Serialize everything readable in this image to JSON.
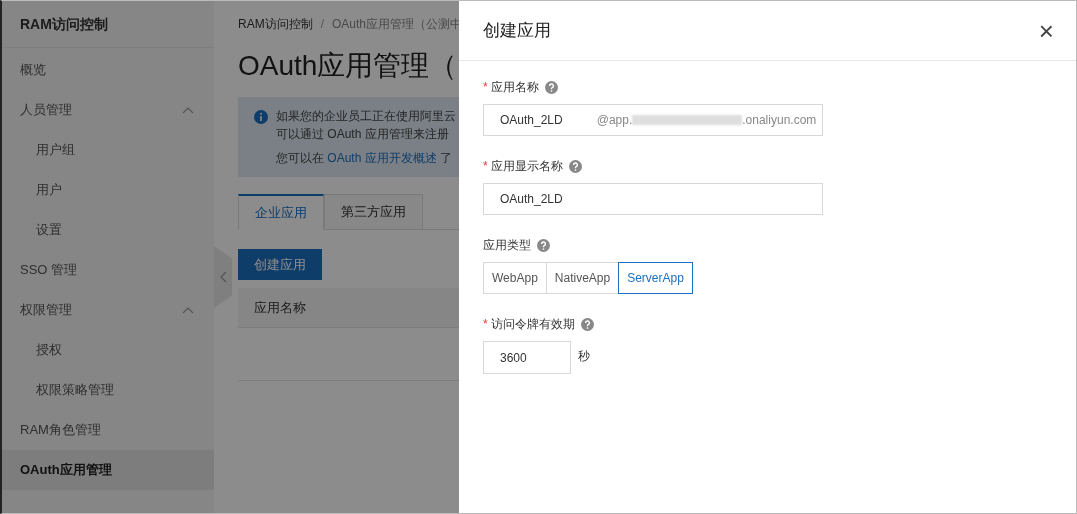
{
  "sidebar": {
    "title": "RAM访问控制",
    "items": [
      {
        "label": "概览",
        "selected": false
      },
      {
        "label": "人员管理",
        "selected": false,
        "expanded": true,
        "children": [
          {
            "label": "用户组",
            "selected": false
          },
          {
            "label": "用户",
            "selected": false
          },
          {
            "label": "设置",
            "selected": false
          }
        ]
      },
      {
        "label": "SSO 管理",
        "selected": false
      },
      {
        "label": "权限管理",
        "selected": false,
        "expanded": true,
        "children": [
          {
            "label": "授权",
            "selected": false
          },
          {
            "label": "权限策略管理",
            "selected": false
          }
        ]
      },
      {
        "label": "RAM角色管理",
        "selected": false
      },
      {
        "label": "OAuth应用管理",
        "selected": true
      }
    ]
  },
  "breadcrumb": {
    "separator": "/",
    "items": [
      "RAM访问控制",
      "OAuth应用管理（公测中"
    ]
  },
  "page_title": "OAuth应用管理（",
  "notice": {
    "lines": [
      "如果您的企业员工正在使用阿里云",
      "可以通过 OAuth 应用管理来注册"
    ],
    "prefix": "您可以在 ",
    "link": "OAuth 应用开发概述",
    "suffix": " 了"
  },
  "tabs": [
    {
      "label": "企业应用",
      "selected": true
    },
    {
      "label": "第三方应用",
      "selected": false
    }
  ],
  "create_button": "创建应用",
  "table": {
    "columns": [
      "应用名称"
    ]
  },
  "drawer": {
    "title": "创建应用",
    "close": "×",
    "required_mark": "*",
    "fields": [
      {
        "kind": "text",
        "label": "应用名称",
        "required": true,
        "value": "OAuth_2LD",
        "suffix_start": "@app.",
        "suffix_end": ".onaliyun.com"
      },
      {
        "kind": "text",
        "label": "应用显示名称",
        "required": true,
        "value": "OAuth_2LD"
      },
      {
        "kind": "segmented",
        "label": "应用类型",
        "required": false,
        "options": [
          {
            "label": "WebApp",
            "selected": false
          },
          {
            "label": "NativeApp",
            "selected": false
          },
          {
            "label": "ServerApp",
            "selected": true
          }
        ]
      },
      {
        "kind": "number",
        "label": "访问令牌有效期",
        "required": true,
        "value": "3600",
        "unit": "秒"
      }
    ]
  }
}
